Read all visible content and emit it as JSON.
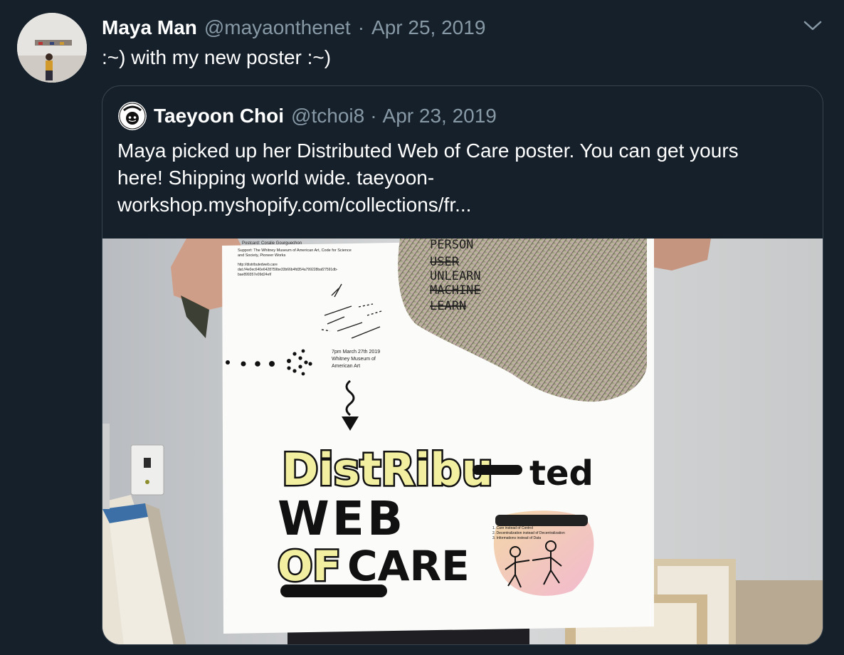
{
  "tweet": {
    "author_name": "Maya Man",
    "author_handle": "@mayaonthenet",
    "separator": "·",
    "date": "Apr 25, 2019",
    "text": ":~) with my new poster :~)"
  },
  "quoted_tweet": {
    "author_name": "Taeyoon Choi",
    "author_handle": "@tchoi8",
    "separator": "·",
    "date": "Apr 23, 2019",
    "text": "Maya picked up her Distributed Web of Care poster. You can get yours\nhere!  Shipping world wide. taeyoon-\nworkshop.myshopify.com/collections/fr..."
  },
  "poster": {
    "credits_line1": "Postcard: Coralie Gourguechon",
    "credits_line2": "Support: The Whitney Museum of American Art, Code for Science",
    "credits_line3": "and Society, Pioneer Works",
    "url_line1": "http://distributedweb.care",
    "url_line2": "dat://4e0ec640e6428759be33b66b4fd354a799228baf27591db-",
    "url_line3": "bae899357e09d24ef/",
    "event_line1": "7pm March 27th 2019",
    "event_line2": "Whitney Museum of",
    "event_line3": "American Art",
    "words_1": "PERSON",
    "words_2": "USER",
    "words_3": "UNLEARN",
    "words_4": "MACHINE",
    "words_5": "LEARN",
    "title_1": "DistRibu",
    "title_2": "ted",
    "title_3": "WEB",
    "title_4": "OF",
    "title_5": "CARE",
    "list_1": "1. Care instead of Control",
    "list_2": "2. Decentralization instead of Decentralization",
    "list_3": "3. Informations instead of Data"
  },
  "icons": {
    "caret": "chevron-down-icon",
    "quoted_avatar": "taeyoon-logo-icon"
  },
  "colors": {
    "background": "#15202b",
    "secondary_text": "#8899a6",
    "border": "#38444d",
    "poster_yellow": "#f2f0a0"
  }
}
